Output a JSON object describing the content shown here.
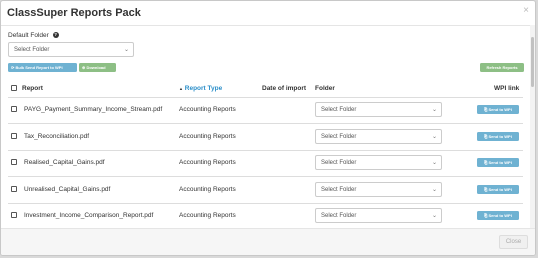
{
  "modal": {
    "title": "ClassSuper Reports Pack",
    "close_glyph": "×"
  },
  "default_folder": {
    "label": "Default Folder",
    "help_glyph": "?",
    "selected": "Select Folder"
  },
  "toolbar": {
    "bulk_send_label": "⟳ Bulk Send Report to WPI",
    "download_label": "⊕ Download",
    "refresh_label": "Refresh Reports"
  },
  "table": {
    "headers": {
      "report": "Report",
      "report_type": "Report Type",
      "sort_glyph": "▲",
      "date_of_import": "Date of import",
      "folder": "Folder",
      "wpi_link": "WPI link"
    },
    "rows": [
      {
        "report": "PAYG_Payment_Summary_Income_Stream.pdf",
        "type": "Accounting Reports",
        "folder": "Select Folder",
        "send": "⎘ Send to WPI"
      },
      {
        "report": "Tax_Reconciliation.pdf",
        "type": "Accounting Reports",
        "folder": "Select Folder",
        "send": "⎘ Send to WPI"
      },
      {
        "report": "Realised_Capital_Gains.pdf",
        "type": "Accounting Reports",
        "folder": "Select Folder",
        "send": "⎘ Send to WPI"
      },
      {
        "report": "Unrealised_Capital_Gains.pdf",
        "type": "Accounting Reports",
        "folder": "Select Folder",
        "send": "⎘ Send to WPI"
      },
      {
        "report": "Investment_Income_Comparison_Report.pdf",
        "type": "Accounting Reports",
        "folder": "Select Folder",
        "send": "⎘ Send to WPI"
      }
    ]
  },
  "footer": {
    "close_label": "Close"
  },
  "colors": {
    "primary_button": "#6fb2d2",
    "success_button": "#8dbf85",
    "link": "#2a8ec9"
  }
}
